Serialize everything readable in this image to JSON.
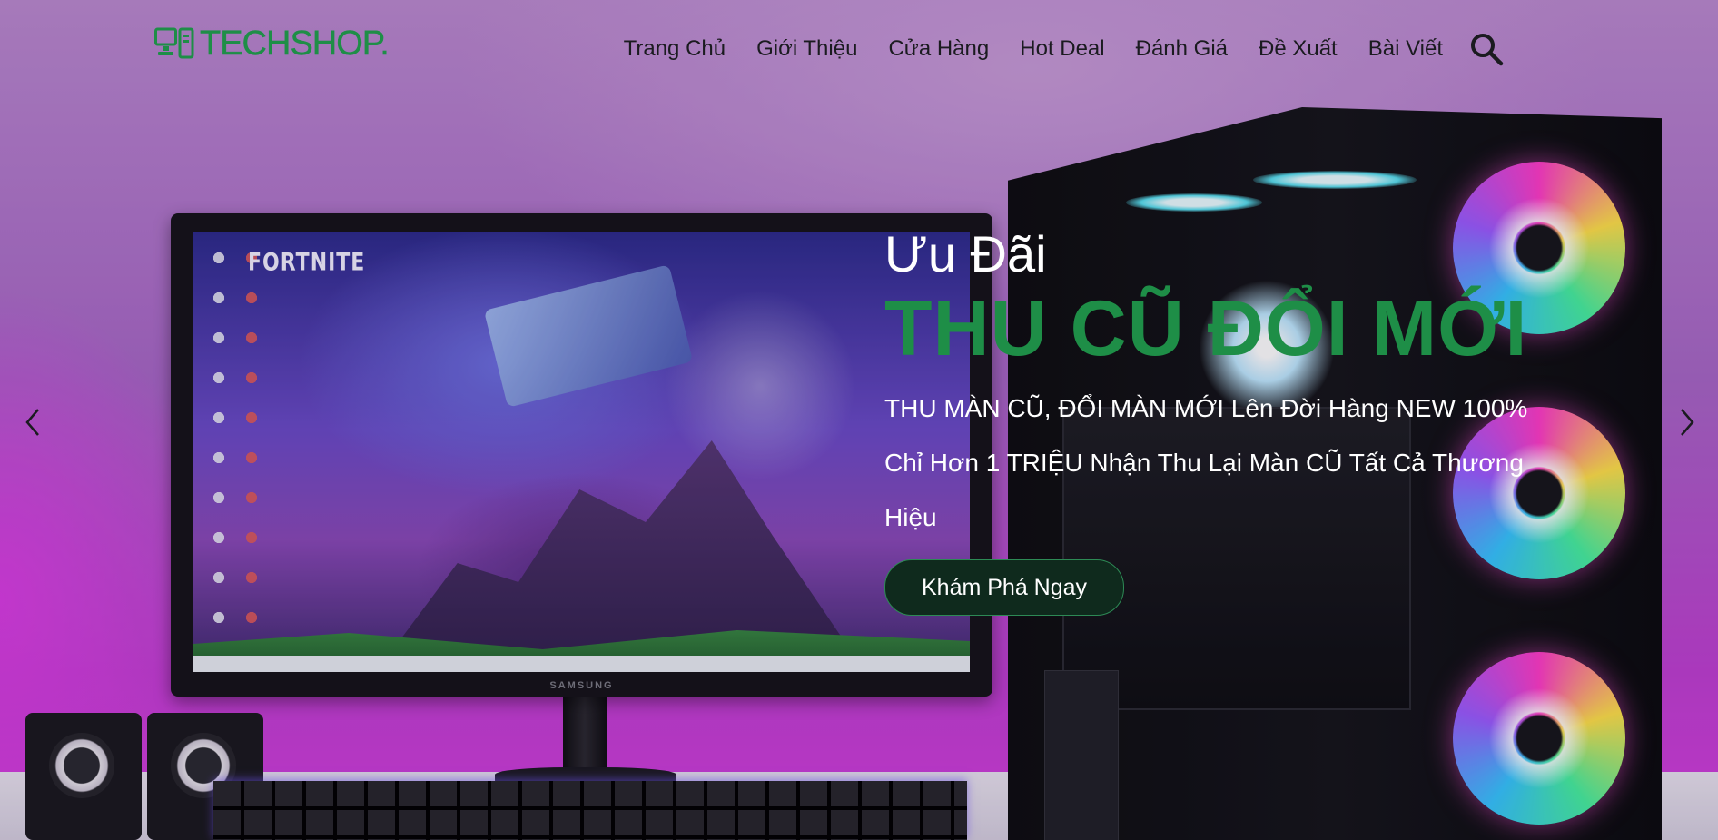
{
  "header": {
    "logo_text": "TECHSHOP.",
    "nav": [
      {
        "label": "Trang Chủ"
      },
      {
        "label": "Giới Thiệu"
      },
      {
        "label": "Cửa Hàng"
      },
      {
        "label": "Hot Deal"
      },
      {
        "label": "Đánh Giá"
      },
      {
        "label": "Đề Xuất"
      },
      {
        "label": "Bài Viết"
      }
    ],
    "search_icon": "search-icon"
  },
  "hero": {
    "eyebrow": "Ưu Đãi",
    "headline": "THU CŨ ĐỔI MỚI",
    "description": "THU MÀN CŨ, ĐỔI MÀN MỚI Lên Đời Hàng NEW 100% Chỉ Hơn 1 TRIỆU Nhận Thu Lại Màn CŨ Tất Cả Thương Hiệu",
    "cta_label": "Khám Phá Ngay",
    "monitor_brand": "SAMSUNG",
    "screen_title": "FORTNITE",
    "prev_icon": "chevron-left-icon",
    "next_icon": "chevron-right-icon"
  },
  "colors": {
    "brand_green": "#1e8e47",
    "cta_bg": "#0f2a1d",
    "nav_text": "#1b1b20"
  }
}
